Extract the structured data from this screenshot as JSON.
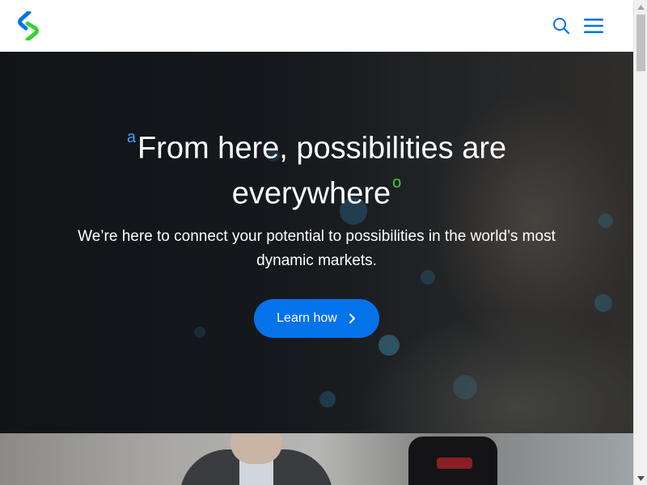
{
  "header": {
    "logo_icon": "standard-chartered-logo",
    "search_icon": "search-icon",
    "menu_icon": "hamburger-menu-icon"
  },
  "hero": {
    "title_mark_start": "a",
    "title_line1": "From here, possibilities are",
    "title_line2": "everywhere",
    "title_mark_end": "o",
    "subtitle": "We’re here to connect your potential to possibilities in the world’s most dynamic markets.",
    "cta_label": "Learn how",
    "cta_icon": "chevron-right-icon"
  },
  "colors": {
    "brand_blue": "#0473ea",
    "brand_green": "#38d430",
    "accent_blue_mark": "#3aa0ff"
  }
}
